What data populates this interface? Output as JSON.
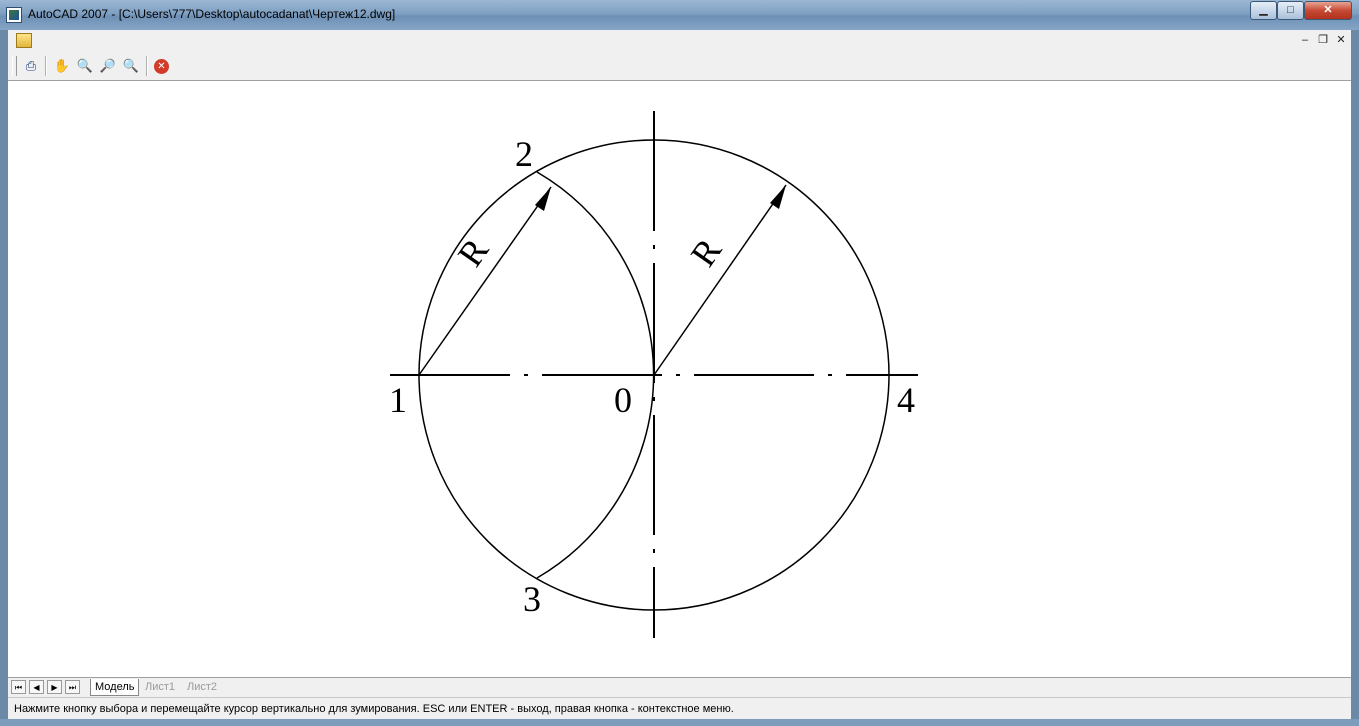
{
  "window": {
    "title": "AutoCAD 2007 - [C:\\Users\\777\\Desktop\\autocadanat\\Чертеж12.dwg]"
  },
  "window_controls": {
    "minimize": "▁",
    "maximize": "□",
    "close": "✕"
  },
  "mdi_controls": {
    "minimize": "–",
    "restore": "❐",
    "close": "✕"
  },
  "toolbar": {
    "icons": [
      "print-icon",
      "pan-icon",
      "zoom-realtime-icon",
      "zoom-window-icon",
      "zoom-previous-icon",
      "close-preview-icon"
    ]
  },
  "drawing": {
    "labels": {
      "p1": "1",
      "p2": "2",
      "p3": "3",
      "p4": "4",
      "center": "0",
      "radius_left": "R",
      "radius_right": "R"
    }
  },
  "tabs": {
    "nav": [
      "⏮",
      "◀",
      "▶",
      "⏭"
    ],
    "items": [
      {
        "label": "Модель",
        "active": true
      },
      {
        "label": "Лист1",
        "active": false
      },
      {
        "label": "Лист2",
        "active": false
      }
    ]
  },
  "status": {
    "message": "Нажмите кнопку выбора и перемещайте курсор вертикально для зумирования. ESC или ENTER - выход, правая кнопка - контекстное меню."
  },
  "colors": {
    "title_bar": "#7fa0c2",
    "close_button": "#c74a34",
    "canvas": "#ffffff"
  }
}
